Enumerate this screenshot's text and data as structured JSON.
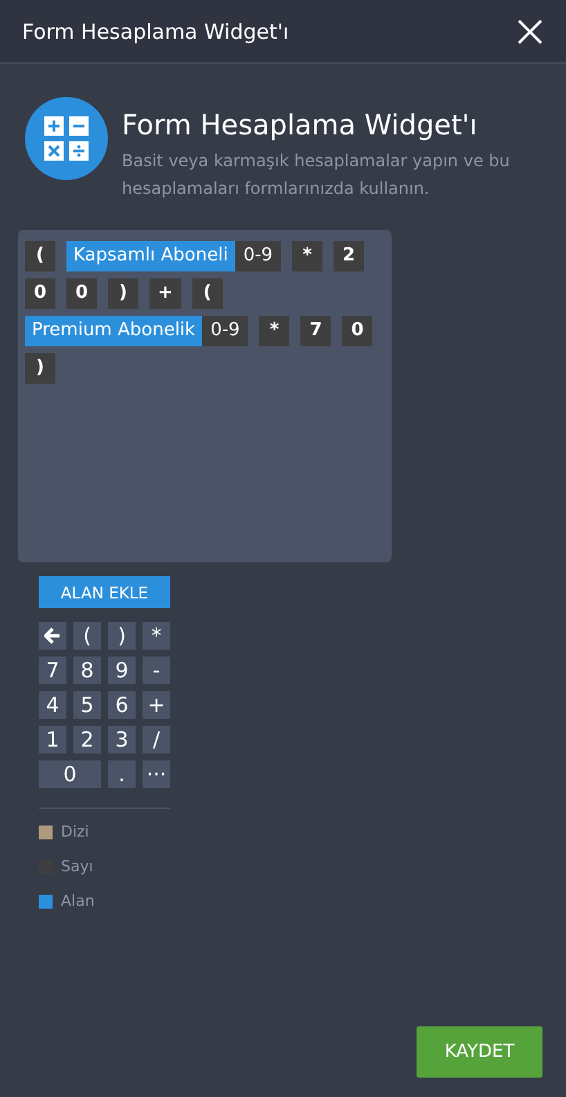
{
  "window": {
    "title": "Form Hesaplama Widget'ı"
  },
  "intro": {
    "title": "Form Hesaplama Widget'ı",
    "description": "Basit veya karmaşık hesaplamalar yapın ve bu hesaplamaları formlarınızda kullanın."
  },
  "formula": [
    {
      "kind": "number",
      "text": "("
    },
    {
      "kind": "field",
      "text": "Kapsamlı Aboneli"
    },
    {
      "kind": "range",
      "text": "0-9"
    },
    {
      "kind": "number",
      "text": "*"
    },
    {
      "kind": "number",
      "text": "2"
    },
    {
      "kind": "number",
      "text": "0"
    },
    {
      "kind": "number",
      "text": "0"
    },
    {
      "kind": "number",
      "text": ")"
    },
    {
      "kind": "number",
      "text": "+"
    },
    {
      "kind": "number",
      "text": "("
    },
    {
      "kind": "field",
      "text": "Premium Abonelik"
    },
    {
      "kind": "range",
      "text": "0-9"
    },
    {
      "kind": "number",
      "text": "*"
    },
    {
      "kind": "number",
      "text": "7"
    },
    {
      "kind": "number",
      "text": "0"
    },
    {
      "kind": "number",
      "text": ")"
    }
  ],
  "add_field_button": "ALAN EKLE",
  "keypad": [
    {
      "kind": "back"
    },
    {
      "kind": "key",
      "text": "("
    },
    {
      "kind": "key",
      "text": ")"
    },
    {
      "kind": "key",
      "text": "*"
    },
    {
      "kind": "key",
      "text": "7"
    },
    {
      "kind": "key",
      "text": "8"
    },
    {
      "kind": "key",
      "text": "9"
    },
    {
      "kind": "key",
      "text": "-"
    },
    {
      "kind": "key",
      "text": "4"
    },
    {
      "kind": "key",
      "text": "5"
    },
    {
      "kind": "key",
      "text": "6"
    },
    {
      "kind": "key",
      "text": "+"
    },
    {
      "kind": "key",
      "text": "1"
    },
    {
      "kind": "key",
      "text": "2"
    },
    {
      "kind": "key",
      "text": "3"
    },
    {
      "kind": "key",
      "text": "/"
    },
    {
      "kind": "wide",
      "text": "0"
    },
    {
      "kind": "key",
      "text": "."
    },
    {
      "kind": "key",
      "text": "···"
    }
  ],
  "legend": [
    {
      "label": "Dizi",
      "color": "#b09a7e"
    },
    {
      "label": "Sayı",
      "color": "#3f3f3f"
    },
    {
      "label": "Alan",
      "color": "#2b8fdc"
    }
  ],
  "save_button": "KAYDET"
}
